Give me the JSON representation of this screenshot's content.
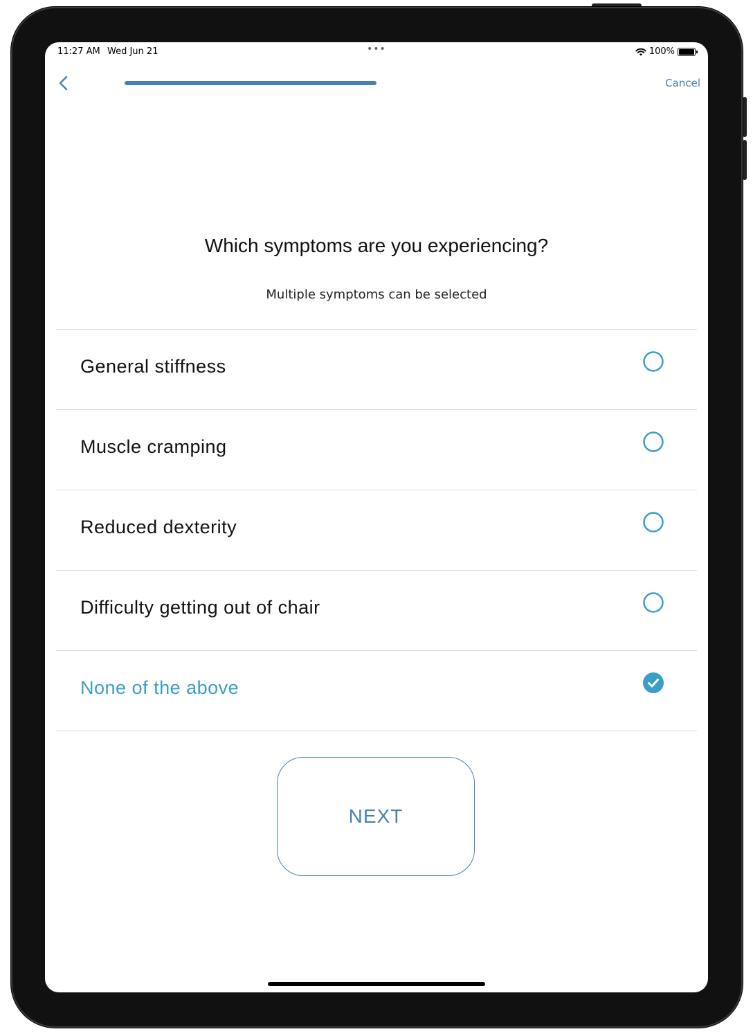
{
  "status_bar": {
    "time": "11:27 AM",
    "date": "Wed Jun 21",
    "battery": "100%",
    "icons": [
      "wifi-icon",
      "battery-icon"
    ]
  },
  "nav": {
    "back_icon": "chevron-left-icon",
    "progress": 1.0,
    "cancel_label": "Cancel"
  },
  "question": {
    "title": "Which symptoms are you experiencing?",
    "subtitle": "Multiple symptoms can be selected"
  },
  "options": [
    {
      "label": "General stiffness",
      "selected": false
    },
    {
      "label": "Muscle cramping",
      "selected": false
    },
    {
      "label": "Reduced dexterity",
      "selected": false
    },
    {
      "label": "Difficulty getting out of chair",
      "selected": false
    },
    {
      "label": "None of the above",
      "selected": true
    }
  ],
  "next_button": {
    "label": "NEXT"
  },
  "colors": {
    "accent": "#4a7fb5",
    "selected": "#3a9ec9",
    "radio": "#3a9ec9"
  }
}
